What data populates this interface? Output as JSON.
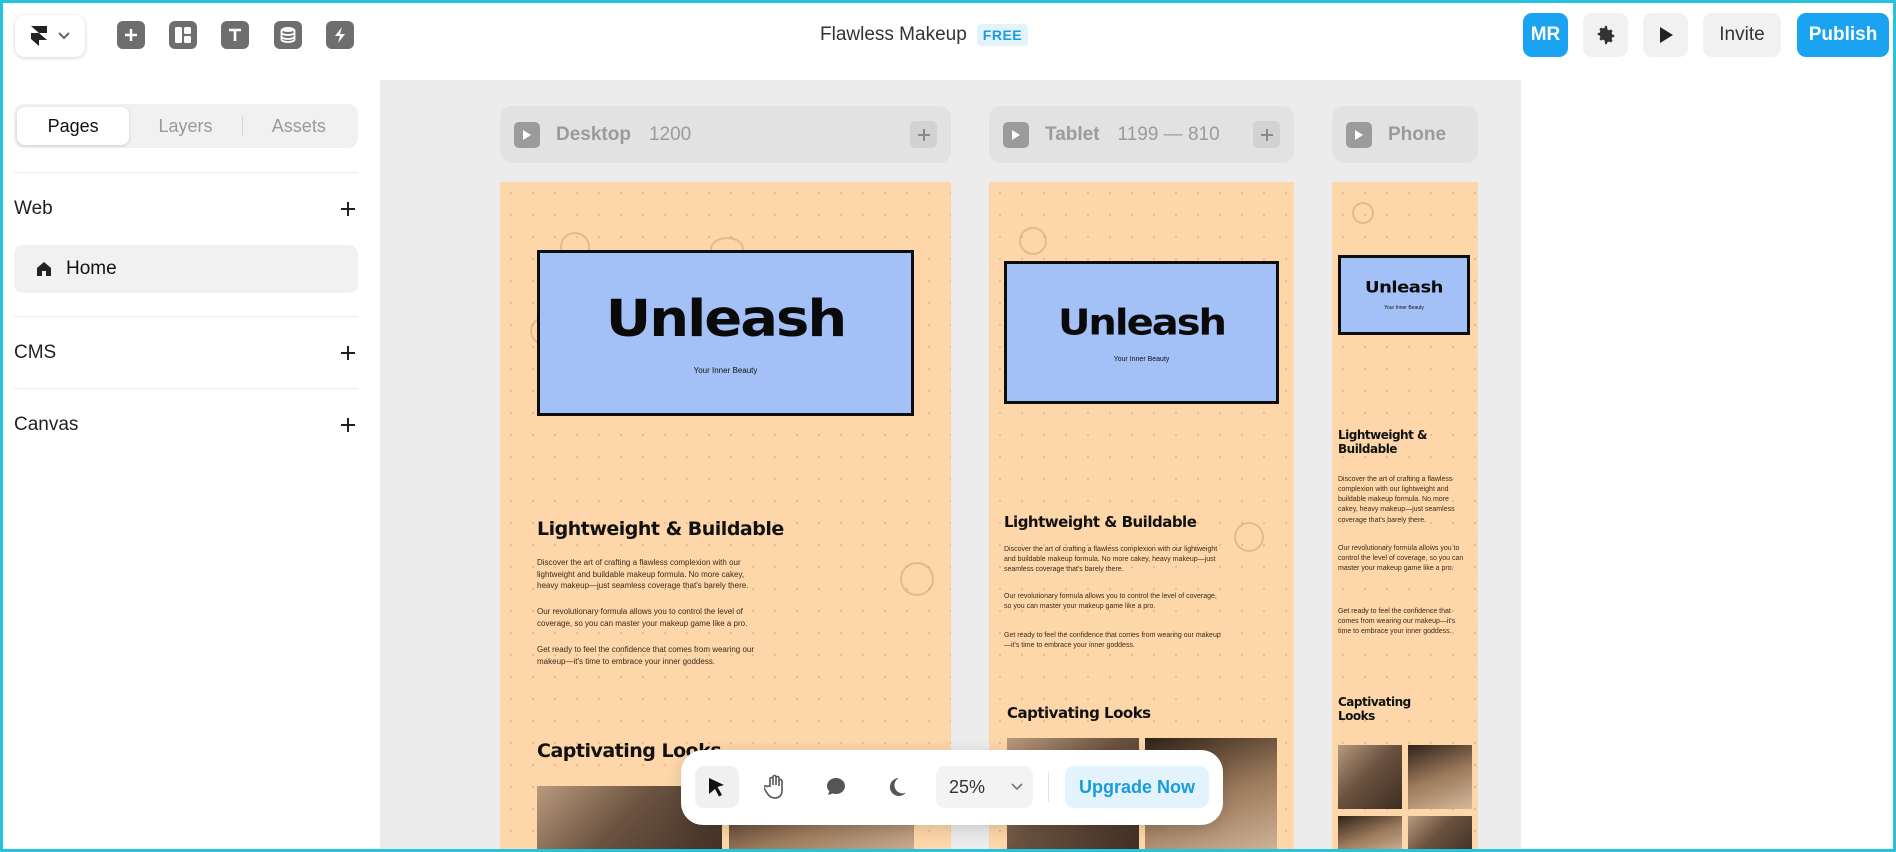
{
  "header": {
    "project_title": "Flawless Makeup",
    "plan_badge": "FREE",
    "avatar_initials": "MR",
    "invite_label": "Invite",
    "publish_label": "Publish",
    "tools": [
      "insert-icon",
      "layout-icon",
      "text-icon",
      "cms-icon",
      "interactions-icon"
    ]
  },
  "sidebar": {
    "tabs": [
      {
        "label": "Pages",
        "active": true
      },
      {
        "label": "Layers",
        "active": false
      },
      {
        "label": "Assets",
        "active": false
      }
    ],
    "sections": [
      {
        "label": "Web",
        "items": [
          {
            "label": "Home",
            "icon": "home-icon",
            "selected": true
          }
        ]
      },
      {
        "label": "CMS",
        "items": []
      },
      {
        "label": "Canvas",
        "items": []
      }
    ]
  },
  "breakpoints": [
    {
      "name": "Desktop",
      "size": "1200"
    },
    {
      "name": "Tablet",
      "size": "1199 — 810"
    },
    {
      "name": "Phone",
      "size": ""
    }
  ],
  "site": {
    "hero_title": "Unleash",
    "hero_subtitle": "Your Inner Beauty",
    "section1_title": "Lightweight & Buildable",
    "section1_paragraphs": [
      "Discover the art of crafting a flawless complexion with our lightweight and buildable makeup formula. No more cakey, heavy makeup—just seamless coverage that's barely there.",
      "Our revolutionary formula allows you to control the level of coverage, so you can master your makeup game like a pro.",
      "Get ready to feel the confidence that comes from wearing our makeup—it's time to embrace your inner goddess."
    ],
    "section2_title": "Captivating Looks"
  },
  "toolbar": {
    "tools": [
      "cursor-icon",
      "hand-icon",
      "comment-icon",
      "dark-mode-icon"
    ],
    "zoom": "25%",
    "upgrade_label": "Upgrade Now"
  },
  "colors": {
    "accent": "#1aa3f0",
    "artboard_bg": "#fdd7a9",
    "hero_bg": "#a3c1f7",
    "window_border": "#27c3dc"
  }
}
